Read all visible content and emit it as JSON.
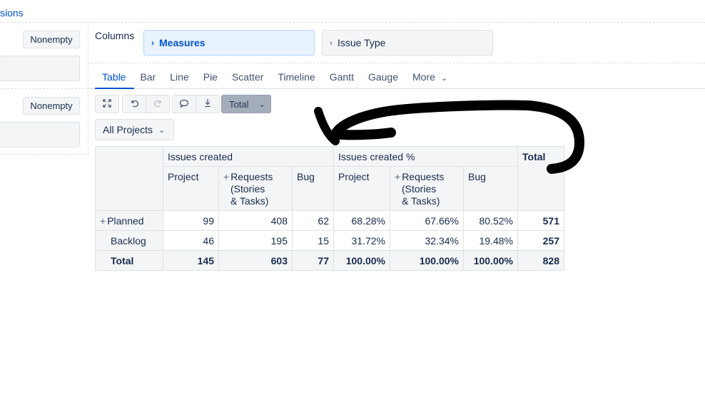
{
  "top_link": "sions",
  "left_panel": {
    "nonempty_1": "Nonempty",
    "nonempty_2": "Nonempty"
  },
  "columns": {
    "label": "Columns",
    "chips": [
      "Measures",
      "Issue Type"
    ]
  },
  "tabs": [
    "Table",
    "Bar",
    "Line",
    "Pie",
    "Scatter",
    "Timeline",
    "Gantt",
    "Gauge",
    "More"
  ],
  "active_tab": "Table",
  "toolbar": {
    "total_label": "Total"
  },
  "filter": {
    "selected": "All Projects"
  },
  "table": {
    "group_headers": [
      "Issues created",
      "Issues created %",
      "Total"
    ],
    "sub_headers": {
      "project": "Project",
      "requests_1": "Requests",
      "requests_2": "(Stories",
      "requests_3": "& Tasks)",
      "bug": "Bug"
    },
    "rows": [
      {
        "label": "Planned",
        "values": [
          "99",
          "408",
          "62",
          "68.28%",
          "67.66%",
          "80.52%",
          "571"
        ]
      },
      {
        "label": "Backlog",
        "values": [
          "46",
          "195",
          "15",
          "31.72%",
          "32.34%",
          "19.48%",
          "257"
        ]
      },
      {
        "label": "Total",
        "values": [
          "145",
          "603",
          "77",
          "100.00%",
          "100.00%",
          "100.00%",
          "828"
        ]
      }
    ]
  },
  "colors": {
    "accent": "#0052cc",
    "panel": "#f4f5f7",
    "border": "#dfe1e6",
    "annotation": "#000000"
  }
}
